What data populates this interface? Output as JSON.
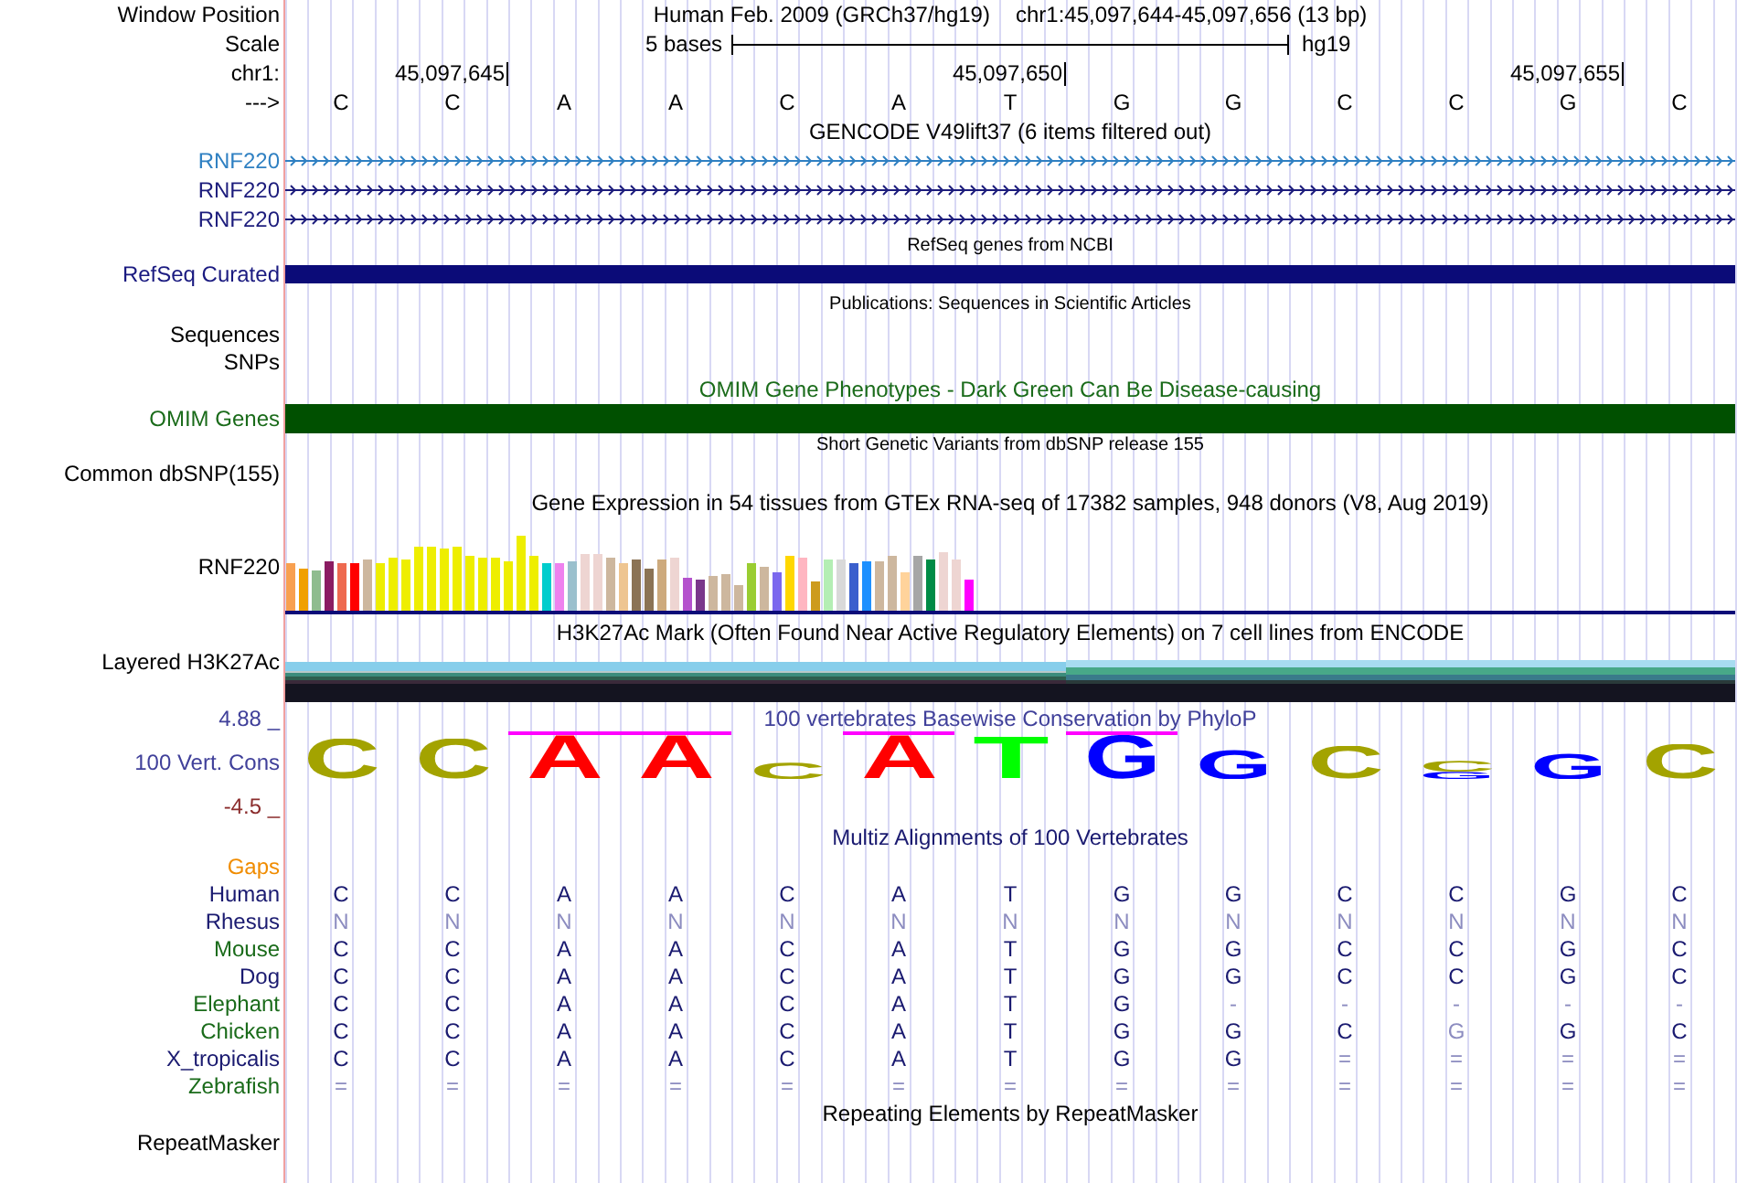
{
  "position": {
    "label": "Window Position",
    "assembly": "Human Feb. 2009 (GRCh37/hg19)",
    "range": "chr1:45,097,644-45,097,656 (13 bp)"
  },
  "scale": {
    "label": "Scale",
    "span": "5 bases",
    "assembly": "hg19"
  },
  "ruler": {
    "label": "chr1:"
  },
  "sequence": {
    "label": "--->",
    "bases": [
      {
        "base": "C"
      },
      {
        "base": "C",
        "tick": "45,097,645"
      },
      {
        "base": "A"
      },
      {
        "base": "A"
      },
      {
        "base": "C"
      },
      {
        "base": "A"
      },
      {
        "base": "T",
        "tick": "45,097,650"
      },
      {
        "base": "G"
      },
      {
        "base": "G"
      },
      {
        "base": "C"
      },
      {
        "base": "C"
      },
      {
        "base": "G",
        "tick": "45,097,655"
      },
      {
        "base": "C"
      }
    ]
  },
  "gencode": {
    "title": "GENCODE V49lift37 (6 items filtered out)",
    "items": [
      {
        "label": "RNF220",
        "color": "#2f80c2"
      },
      {
        "label": "RNF220",
        "color": "#1c1c7c"
      },
      {
        "label": "RNF220",
        "color": "#1c1c7c"
      }
    ]
  },
  "refseq": {
    "title": "RefSeq genes from NCBI",
    "label": "RefSeq Curated"
  },
  "publications": {
    "title": "Publications: Sequences in Scientific Articles",
    "labels": [
      "Sequences",
      "SNPs"
    ]
  },
  "omim": {
    "title": "OMIM Gene Phenotypes - Dark Green Can Be Disease-causing",
    "label": "OMIM Genes"
  },
  "dbsnp": {
    "title": "Short Genetic Variants from dbSNP release 155",
    "label": "Common dbSNP(155)"
  },
  "gtex": {
    "title": "Gene Expression in 54 tissues from GTEx RNA-seq of 17382 samples, 948 donors (V8, Aug 2019)",
    "label": "RNF220"
  },
  "h3k27ac": {
    "title": "H3K27Ac Mark (Often Found Near Active Regulatory Elements) on 7 cell lines from ENCODE",
    "label": "Layered H3K27Ac"
  },
  "conservation": {
    "title": "100 vertebrates Basewise Conservation by PhyloP",
    "label": "100 Vert. Cons",
    "max": "4.88 _",
    "min": "-4.5 _",
    "columns": [
      {
        "clipped": false,
        "letters": [
          {
            "base": "C",
            "color": "#a3a300"
          }
        ]
      },
      {
        "clipped": false,
        "letters": [
          {
            "base": "C",
            "color": "#a3a300"
          }
        ]
      },
      {
        "clipped": true,
        "letters": [
          {
            "base": "A",
            "color": "#ff0000"
          }
        ]
      },
      {
        "clipped": true,
        "letters": [
          {
            "base": "A",
            "color": "#ff0000"
          }
        ]
      },
      {
        "clipped": false,
        "letters": [
          {
            "base": "C",
            "color": "#a3a300"
          }
        ]
      },
      {
        "clipped": true,
        "letters": [
          {
            "base": "A",
            "color": "#ff0000"
          }
        ]
      },
      {
        "clipped": false,
        "letters": [
          {
            "base": "T",
            "color": "#00ff00"
          }
        ]
      },
      {
        "clipped": true,
        "letters": [
          {
            "base": "G",
            "color": "#0000ff"
          }
        ]
      },
      {
        "clipped": false,
        "letters": [
          {
            "base": "G",
            "color": "#0000ff"
          }
        ]
      },
      {
        "clipped": false,
        "letters": [
          {
            "base": "C",
            "color": "#a3a300"
          }
        ]
      },
      {
        "clipped": false,
        "letters": [
          {
            "base": "C",
            "color": "#a3a300"
          },
          {
            "base": "G",
            "color": "#0000ff"
          }
        ]
      },
      {
        "clipped": false,
        "letters": [
          {
            "base": "G",
            "color": "#0000ff"
          }
        ]
      },
      {
        "clipped": false,
        "letters": [
          {
            "base": "C",
            "color": "#a3a300"
          }
        ]
      }
    ]
  },
  "multiz": {
    "title": "Multiz Alignments of 100 Vertebrates",
    "gaps_label": "Gaps",
    "species": [
      {
        "name": "Human",
        "color": "#1a1a70",
        "bases": [
          {
            "base": "C",
            "faded": false
          },
          {
            "base": "C",
            "faded": false
          },
          {
            "base": "A",
            "faded": false
          },
          {
            "base": "A",
            "faded": false
          },
          {
            "base": "C",
            "faded": false
          },
          {
            "base": "A",
            "faded": false
          },
          {
            "base": "T",
            "faded": false
          },
          {
            "base": "G",
            "faded": false
          },
          {
            "base": "G",
            "faded": false
          },
          {
            "base": "C",
            "faded": false
          },
          {
            "base": "C",
            "faded": false
          },
          {
            "base": "G",
            "faded": false
          },
          {
            "base": "C",
            "faded": false
          }
        ]
      },
      {
        "name": "Rhesus",
        "color": "#1a1a70",
        "bases": [
          {
            "base": "N",
            "faded": true
          },
          {
            "base": "N",
            "faded": true
          },
          {
            "base": "N",
            "faded": true
          },
          {
            "base": "N",
            "faded": true
          },
          {
            "base": "N",
            "faded": true
          },
          {
            "base": "N",
            "faded": true
          },
          {
            "base": "N",
            "faded": true
          },
          {
            "base": "N",
            "faded": true
          },
          {
            "base": "N",
            "faded": true
          },
          {
            "base": "N",
            "faded": true
          },
          {
            "base": "N",
            "faded": true
          },
          {
            "base": "N",
            "faded": true
          },
          {
            "base": "N",
            "faded": true
          }
        ]
      },
      {
        "name": "Mouse",
        "color": "#1a6b1a",
        "bases": [
          {
            "base": "C",
            "faded": false
          },
          {
            "base": "C",
            "faded": false
          },
          {
            "base": "A",
            "faded": false
          },
          {
            "base": "A",
            "faded": false
          },
          {
            "base": "C",
            "faded": false
          },
          {
            "base": "A",
            "faded": false
          },
          {
            "base": "T",
            "faded": false
          },
          {
            "base": "G",
            "faded": false
          },
          {
            "base": "G",
            "faded": false
          },
          {
            "base": "C",
            "faded": false
          },
          {
            "base": "C",
            "faded": false
          },
          {
            "base": "G",
            "faded": false
          },
          {
            "base": "C",
            "faded": false
          }
        ]
      },
      {
        "name": "Dog",
        "color": "#1a1a70",
        "bases": [
          {
            "base": "C",
            "faded": false
          },
          {
            "base": "C",
            "faded": false
          },
          {
            "base": "A",
            "faded": false
          },
          {
            "base": "A",
            "faded": false
          },
          {
            "base": "C",
            "faded": false
          },
          {
            "base": "A",
            "faded": false
          },
          {
            "base": "T",
            "faded": false
          },
          {
            "base": "G",
            "faded": false
          },
          {
            "base": "G",
            "faded": false
          },
          {
            "base": "C",
            "faded": false
          },
          {
            "base": "C",
            "faded": false
          },
          {
            "base": "G",
            "faded": false
          },
          {
            "base": "C",
            "faded": false
          }
        ]
      },
      {
        "name": "Elephant",
        "color": "#1a6b1a",
        "bases": [
          {
            "base": "C",
            "faded": false
          },
          {
            "base": "C",
            "faded": false
          },
          {
            "base": "A",
            "faded": false
          },
          {
            "base": "A",
            "faded": false
          },
          {
            "base": "C",
            "faded": false
          },
          {
            "base": "A",
            "faded": false
          },
          {
            "base": "T",
            "faded": false
          },
          {
            "base": "G",
            "faded": false
          },
          {
            "base": "-",
            "faded": true
          },
          {
            "base": "-",
            "faded": true
          },
          {
            "base": "-",
            "faded": true
          },
          {
            "base": "-",
            "faded": true
          },
          {
            "base": "-",
            "faded": true
          }
        ]
      },
      {
        "name": "Chicken",
        "color": "#1a6b1a",
        "bases": [
          {
            "base": "C",
            "faded": false
          },
          {
            "base": "C",
            "faded": false
          },
          {
            "base": "A",
            "faded": false
          },
          {
            "base": "A",
            "faded": false
          },
          {
            "base": "C",
            "faded": false
          },
          {
            "base": "A",
            "faded": false
          },
          {
            "base": "T",
            "faded": false
          },
          {
            "base": "G",
            "faded": false
          },
          {
            "base": "G",
            "faded": false
          },
          {
            "base": "C",
            "faded": false
          },
          {
            "base": "G",
            "faded": true
          },
          {
            "base": "G",
            "faded": false
          },
          {
            "base": "C",
            "faded": false
          }
        ]
      },
      {
        "name": "X_tropicalis",
        "color": "#1a1a70",
        "bases": [
          {
            "base": "C",
            "faded": false
          },
          {
            "base": "C",
            "faded": false
          },
          {
            "base": "A",
            "faded": false
          },
          {
            "base": "A",
            "faded": false
          },
          {
            "base": "C",
            "faded": false
          },
          {
            "base": "A",
            "faded": false
          },
          {
            "base": "T",
            "faded": false
          },
          {
            "base": "G",
            "faded": false
          },
          {
            "base": "G",
            "faded": false
          },
          {
            "base": "=",
            "faded": true
          },
          {
            "base": "=",
            "faded": true
          },
          {
            "base": "=",
            "faded": true
          },
          {
            "base": "=",
            "faded": true
          }
        ]
      },
      {
        "name": "Zebrafish",
        "color": "#1a6b1a",
        "bases": [
          {
            "base": "=",
            "faded": true
          },
          {
            "base": "=",
            "faded": true
          },
          {
            "base": "=",
            "faded": true
          },
          {
            "base": "=",
            "faded": true
          },
          {
            "base": "=",
            "faded": true
          },
          {
            "base": "=",
            "faded": true
          },
          {
            "base": "=",
            "faded": true
          },
          {
            "base": "=",
            "faded": true
          },
          {
            "base": "=",
            "faded": true
          },
          {
            "base": "=",
            "faded": true
          },
          {
            "base": "=",
            "faded": true
          },
          {
            "base": "=",
            "faded": true
          },
          {
            "base": "=",
            "faded": true
          }
        ]
      }
    ]
  },
  "repeatmasker": {
    "title": "Repeating Elements by RepeatMasker",
    "label": "RepeatMasker"
  }
}
